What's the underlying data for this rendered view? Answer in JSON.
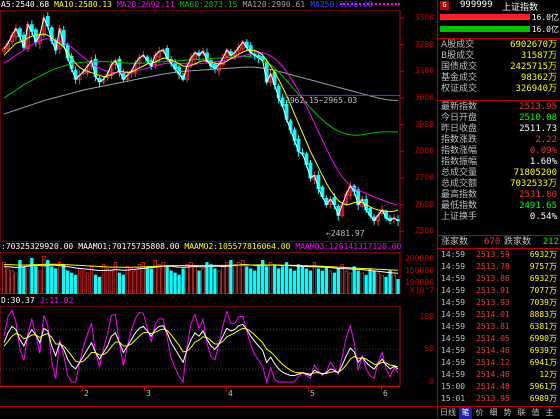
{
  "main_legend": {
    "items": [
      {
        "text": "A5:2540.68",
        "color": "#ffffff"
      },
      {
        "text": "MA10:2580.13",
        "color": "#ffff00"
      },
      {
        "text": "MA20:2692.11",
        "color": "#ff00ff"
      },
      {
        "text": "MA60:2873.15",
        "color": "#00c000"
      },
      {
        "text": "MA120:2990.61",
        "color": "#a0a0a0"
      },
      {
        "text": "MA250:3026.28",
        "color": "#4040ff"
      }
    ]
  },
  "vol_legend": {
    "items": [
      {
        "text": ":70325329920.00",
        "color": "#ffffff"
      },
      {
        "text": "MAAMO1:70175735808.00",
        "color": "#ffffff"
      },
      {
        "text": "MAAMO2:105577816064.00",
        "color": "#ffff00"
      },
      {
        "text": "MAAMO3:126141317120.00",
        "color": "#ff00ff"
      }
    ]
  },
  "ind_legend": {
    "items": [
      {
        "text": "D:30.37",
        "color": "#ffffff"
      },
      {
        "text": "J:11.02",
        "color": "#ff00ff"
      }
    ]
  },
  "price_axis": [
    "3300",
    "3200",
    "3100",
    "3000",
    "2900",
    "2800",
    "2700",
    "2600",
    "2500"
  ],
  "vol_axis": [
    "200000",
    "150000",
    "100000",
    "X10^7"
  ],
  "ind_axis": [
    "100",
    "50",
    "0"
  ],
  "x_ticks": [
    "2",
    "3",
    "4",
    "5",
    "6"
  ],
  "annotations": {
    "high": "2962.15~2965.03",
    "low": "←2481.97"
  },
  "chart_data": {
    "type": "candlestick",
    "ylim": [
      2460,
      3330
    ],
    "closes": [
      3185,
      3205,
      3235,
      3260,
      3230,
      3190,
      3275,
      3250,
      3210,
      3235,
      3300,
      3270,
      3215,
      3180,
      3260,
      3200,
      3150,
      3110,
      3070,
      3085,
      3100,
      3120,
      3140,
      3080,
      3060,
      3070,
      3090,
      3125,
      3140,
      3100,
      3070,
      3085,
      3100,
      3130,
      3150,
      3160,
      3140,
      3120,
      3160,
      3175,
      3180,
      3150,
      3130,
      3110,
      3090,
      3070,
      3120,
      3150,
      3170,
      3160,
      3175,
      3140,
      3120,
      3110,
      3125,
      3150,
      3180,
      3160,
      3170,
      3190,
      3210,
      3190,
      3170,
      3160,
      3150,
      3140,
      3060,
      3090,
      3050,
      3000,
      2970,
      2920,
      2880,
      2840,
      2800,
      2790,
      2750,
      2700,
      2710,
      2660,
      2630,
      2600,
      2620,
      2600,
      2560,
      2600,
      2640,
      2670,
      2650,
      2600,
      2620,
      2580,
      2560,
      2540,
      2560,
      2580,
      2550,
      2540,
      2550,
      2540
    ],
    "ma10": [
      3160,
      3175,
      3190,
      3205,
      3210,
      3215,
      3225,
      3232,
      3236,
      3238,
      3240,
      3235,
      3225,
      3215,
      3205,
      3190,
      3170,
      3150,
      3130,
      3115,
      3105,
      3100,
      3095,
      3090,
      3085,
      3080,
      3082,
      3088,
      3095,
      3100,
      3098,
      3096,
      3098,
      3105,
      3112,
      3120,
      3128,
      3130,
      3135,
      3142,
      3150,
      3148,
      3142,
      3136,
      3128,
      3120,
      3118,
      3122,
      3128,
      3135,
      3140,
      3138,
      3134,
      3130,
      3128,
      3130,
      3138,
      3148,
      3155,
      3165,
      3172,
      3178,
      3180,
      3178,
      3172,
      3160,
      3140,
      3120,
      3095,
      3070,
      3040,
      3010,
      2975,
      2940,
      2905,
      2870,
      2835,
      2800,
      2770,
      2740,
      2710,
      2680,
      2655,
      2635,
      2615,
      2605,
      2600,
      2602,
      2608,
      2610,
      2608,
      2600,
      2592,
      2585,
      2580,
      2578,
      2576,
      2574,
      2575,
      2580
    ],
    "ma20": [
      3130,
      3140,
      3150,
      3160,
      3170,
      3180,
      3190,
      3200,
      3208,
      3215,
      3220,
      3222,
      3220,
      3218,
      3214,
      3208,
      3200,
      3190,
      3178,
      3165,
      3152,
      3140,
      3130,
      3120,
      3112,
      3105,
      3100,
      3097,
      3095,
      3094,
      3094,
      3095,
      3097,
      3100,
      3104,
      3108,
      3112,
      3116,
      3120,
      3124,
      3128,
      3130,
      3131,
      3131,
      3130,
      3129,
      3128,
      3127,
      3127,
      3128,
      3130,
      3132,
      3134,
      3136,
      3138,
      3140,
      3143,
      3146,
      3150,
      3154,
      3158,
      3162,
      3165,
      3168,
      3170,
      3170,
      3165,
      3158,
      3148,
      3135,
      3118,
      3098,
      3076,
      3052,
      3026,
      2998,
      2968,
      2938,
      2906,
      2874,
      2842,
      2810,
      2780,
      2752,
      2726,
      2704,
      2686,
      2672,
      2662,
      2654,
      2648,
      2642,
      2636,
      2630,
      2624,
      2618,
      2612,
      2606,
      2602,
      2598
    ],
    "ma60": [
      3000,
      3010,
      3020,
      3030,
      3040,
      3050,
      3058,
      3066,
      3074,
      3082,
      3090,
      3097,
      3104,
      3110,
      3115,
      3120,
      3124,
      3127,
      3130,
      3132,
      3134,
      3135,
      3136,
      3137,
      3137,
      3137,
      3136,
      3135,
      3134,
      3133,
      3132,
      3131,
      3130,
      3130,
      3130,
      3131,
      3132,
      3133,
      3134,
      3135,
      3136,
      3137,
      3138,
      3139,
      3140,
      3141,
      3142,
      3143,
      3144,
      3145,
      3146,
      3147,
      3148,
      3149,
      3150,
      3151,
      3152,
      3153,
      3154,
      3155,
      3156,
      3156,
      3155,
      3152,
      3148,
      3142,
      3134,
      3124,
      3112,
      3098,
      3082,
      3065,
      3048,
      3031,
      3014,
      2997,
      2980,
      2963,
      2947,
      2932,
      2918,
      2905,
      2894,
      2884,
      2876,
      2870,
      2865,
      2862,
      2860,
      2860,
      2862,
      2865,
      2868,
      2870,
      2872,
      2873,
      2873,
      2873,
      2873,
      2873
    ],
    "ma120": [
      2940,
      2945,
      2950,
      2955,
      2960,
      2965,
      2970,
      2975,
      2980,
      2985,
      2990,
      2994,
      2998,
      3002,
      3006,
      3010,
      3014,
      3018,
      3022,
      3026,
      3030,
      3033,
      3036,
      3039,
      3042,
      3045,
      3048,
      3051,
      3054,
      3057,
      3060,
      3063,
      3066,
      3069,
      3072,
      3075,
      3078,
      3081,
      3084,
      3087,
      3090,
      3092,
      3094,
      3096,
      3098,
      3100,
      3101,
      3102,
      3103,
      3104,
      3105,
      3106,
      3107,
      3108,
      3109,
      3110,
      3111,
      3112,
      3113,
      3114,
      3115,
      3116,
      3116,
      3115,
      3114,
      3112,
      3110,
      3107,
      3104,
      3100,
      3096,
      3092,
      3088,
      3084,
      3080,
      3076,
      3072,
      3068,
      3064,
      3060,
      3056,
      3052,
      3048,
      3044,
      3040,
      3036,
      3032,
      3028,
      3024,
      3020,
      3016,
      3012,
      3008,
      3004,
      3000,
      2997,
      2994,
      2992,
      2991,
      2991
    ],
    "volumes": [
      150,
      120,
      110,
      100,
      160,
      130,
      120,
      170,
      140,
      110,
      180,
      160,
      130,
      120,
      150,
      140,
      110,
      100,
      90,
      120,
      110,
      100,
      130,
      90,
      80,
      140,
      120,
      110,
      150,
      100,
      90,
      130,
      120,
      110,
      140,
      150,
      130,
      120,
      160,
      140,
      150,
      130,
      110,
      100,
      90,
      120,
      140,
      150,
      130,
      110,
      120,
      150,
      140,
      120,
      110,
      130,
      150,
      160,
      140,
      150,
      160,
      130,
      120,
      110,
      140,
      160,
      130,
      150,
      140,
      120,
      130,
      150,
      120,
      110,
      140,
      130,
      120,
      110,
      150,
      120,
      110,
      130,
      110,
      100,
      120,
      140,
      110,
      100,
      130,
      110,
      100,
      90,
      120,
      110,
      100,
      90,
      80,
      110,
      90,
      70
    ],
    "vma1": [
      130,
      130,
      128,
      126,
      128,
      130,
      132,
      135,
      136,
      135,
      134,
      136,
      138,
      137,
      135,
      133,
      130,
      127,
      124,
      122,
      120,
      118,
      116,
      114,
      112,
      112,
      113,
      114,
      116,
      115,
      113,
      114,
      116,
      118,
      120,
      122,
      124,
      126,
      128,
      130,
      132,
      133,
      132,
      130,
      128,
      127,
      128,
      130,
      131,
      130,
      129,
      130,
      132,
      133,
      132,
      131,
      132,
      134,
      136,
      138,
      140,
      140,
      138,
      136,
      135,
      136,
      137,
      138,
      138,
      137,
      136,
      136,
      135,
      134,
      133,
      132,
      131,
      130,
      130,
      129,
      128,
      127,
      126,
      124,
      122,
      121,
      120,
      119,
      118,
      117,
      116,
      114,
      112,
      110,
      108,
      106,
      104,
      102,
      100,
      98
    ],
    "vma2": [
      140,
      140,
      139,
      138,
      138,
      138,
      138,
      139,
      140,
      140,
      141,
      142,
      142,
      142,
      141,
      140,
      139,
      138,
      137,
      136,
      135,
      134,
      133,
      132,
      131,
      130,
      129,
      128,
      128,
      127,
      127,
      127,
      127,
      128,
      128,
      129,
      130,
      131,
      132,
      133,
      134,
      135,
      135,
      135,
      135,
      135,
      135,
      135,
      135,
      135,
      135,
      135,
      136,
      136,
      136,
      136,
      136,
      137,
      137,
      138,
      138,
      138,
      138,
      138,
      138,
      138,
      138,
      138,
      138,
      138,
      137,
      137,
      137,
      136,
      136,
      135,
      135,
      134,
      134,
      133,
      132,
      131,
      130,
      129,
      128,
      127,
      126,
      125,
      124,
      123,
      122,
      121,
      120,
      119,
      118,
      117,
      116,
      115,
      114,
      113
    ],
    "kdj_k": [
      60,
      75,
      85,
      80,
      65,
      55,
      70,
      80,
      72,
      60,
      82,
      78,
      55,
      40,
      60,
      50,
      35,
      25,
      20,
      30,
      40,
      50,
      60,
      45,
      35,
      45,
      55,
      70,
      75,
      60,
      45,
      55,
      65,
      75,
      82,
      85,
      78,
      70,
      80,
      85,
      86,
      75,
      60,
      50,
      40,
      30,
      50,
      65,
      75,
      70,
      78,
      65,
      55,
      50,
      58,
      70,
      82,
      78,
      80,
      86,
      88,
      80,
      70,
      62,
      55,
      48,
      30,
      38,
      28,
      20,
      15,
      12,
      10,
      10,
      12,
      14,
      12,
      10,
      18,
      15,
      12,
      14,
      20,
      18,
      14,
      26,
      40,
      52,
      46,
      30,
      38,
      30,
      24,
      20,
      28,
      35,
      26,
      20,
      24,
      20
    ],
    "kdj_d": [
      55,
      62,
      70,
      74,
      72,
      66,
      68,
      72,
      72,
      68,
      72,
      74,
      68,
      58,
      58,
      55,
      48,
      40,
      32,
      30,
      32,
      38,
      45,
      45,
      41,
      42,
      46,
      54,
      61,
      61,
      55,
      55,
      58,
      64,
      70,
      75,
      76,
      74,
      76,
      79,
      81,
      79,
      72,
      64,
      56,
      46,
      47,
      53,
      61,
      64,
      69,
      68,
      63,
      58,
      58,
      62,
      69,
      72,
      75,
      79,
      82,
      81,
      77,
      72,
      66,
      60,
      50,
      46,
      40,
      33,
      27,
      22,
      18,
      15,
      14,
      14,
      13,
      12,
      14,
      14,
      13,
      13,
      15,
      16,
      15,
      19,
      26,
      35,
      39,
      36,
      37,
      35,
      31,
      27,
      27,
      30,
      29,
      26,
      25,
      23
    ],
    "kdj_j": [
      70,
      100,
      110,
      92,
      50,
      33,
      74,
      96,
      72,
      44,
      102,
      86,
      30,
      5,
      64,
      40,
      10,
      0,
      0,
      30,
      55,
      74,
      90,
      45,
      23,
      51,
      73,
      102,
      103,
      58,
      25,
      55,
      79,
      97,
      106,
      105,
      82,
      62,
      88,
      97,
      96,
      67,
      36,
      22,
      8,
      0,
      56,
      89,
      103,
      82,
      96,
      59,
      39,
      34,
      58,
      86,
      108,
      90,
      90,
      100,
      100,
      78,
      56,
      42,
      33,
      24,
      0,
      22,
      4,
      0,
      0,
      0,
      0,
      0,
      8,
      14,
      10,
      6,
      26,
      17,
      10,
      16,
      30,
      22,
      12,
      40,
      68,
      86,
      60,
      18,
      40,
      20,
      10,
      6,
      30,
      45,
      20,
      8,
      22,
      14
    ]
  },
  "right_panel": {
    "header_code": "999999",
    "header_name": "上证指数",
    "header_badge": "G",
    "bar1_val": "16.0亿",
    "bar2_val": "16.0亿",
    "stats": [
      {
        "label": "A股成交",
        "value": "6902670万",
        "color": "#ffff00"
      },
      {
        "label": "B股成交",
        "value": "31587万",
        "color": "#ffff00"
      },
      {
        "label": "国债成交",
        "value": "2425715万",
        "color": "#ffff00"
      },
      {
        "label": "基金成交",
        "value": "98362万",
        "color": "#ffff00"
      },
      {
        "label": "权证成交",
        "value": "326940万",
        "color": "#ffff00"
      }
    ],
    "quotes": [
      {
        "label": "最新指数",
        "value": "2513.95",
        "color": "#ff3030"
      },
      {
        "label": "今日开盘",
        "value": "2510.08",
        "color": "#00ff00"
      },
      {
        "label": "昨日收盘",
        "value": "2511.73",
        "color": "#ffffff"
      },
      {
        "label": "指数涨跌",
        "value": "2.22",
        "color": "#ff3030"
      },
      {
        "label": "指数涨幅",
        "value": "0.09%",
        "color": "#ff3030"
      },
      {
        "label": "指数振幅",
        "value": "1.60%",
        "color": "#ffffff"
      },
      {
        "label": "总成交量",
        "value": "71805200",
        "color": "#ffff00"
      },
      {
        "label": "总成交额",
        "value": "7032533万",
        "color": "#ffff00"
      },
      {
        "label": "最高指数",
        "value": "2531.80",
        "color": "#ff3030"
      },
      {
        "label": "最低指数",
        "value": "2491.65",
        "color": "#00ff00"
      },
      {
        "label": "上证换手",
        "value": "0.54%",
        "color": "#ffffff"
      }
    ],
    "updown": {
      "up_label": "涨家数",
      "up_value": "670",
      "down_label": "跌家数",
      "down_value": "212"
    },
    "trades": [
      {
        "time": "14:59",
        "price": "2513.59",
        "vol": "6932万"
      },
      {
        "time": "14:59",
        "price": "2513.78",
        "vol": "9757万"
      },
      {
        "time": "14:59",
        "price": "2513.86",
        "vol": "6932万"
      },
      {
        "time": "14:59",
        "price": "2513.91",
        "vol": "7077万"
      },
      {
        "time": "14:59",
        "price": "2513.93",
        "vol": "7039万"
      },
      {
        "time": "14:59",
        "price": "2514.01",
        "vol": "8883万"
      },
      {
        "time": "14:59",
        "price": "2513.81",
        "vol": "6381万"
      },
      {
        "time": "14:59",
        "price": "2514.05",
        "vol": "6990万"
      },
      {
        "time": "14:59",
        "price": "2514.46",
        "vol": "6939万"
      },
      {
        "time": "14:59",
        "price": "2514.12",
        "vol": "6941万"
      },
      {
        "time": "14:59",
        "price": "2514.46",
        "vol": "12万"
      },
      {
        "time": "15:00",
        "price": "2514.48",
        "vol": "5961万"
      },
      {
        "time": "15:01",
        "price": "2513.95",
        "vol": "6989万"
      }
    ]
  },
  "bottom_tabs": [
    "日线",
    "笔",
    "价",
    "细",
    "势",
    "联",
    "值",
    "主"
  ]
}
